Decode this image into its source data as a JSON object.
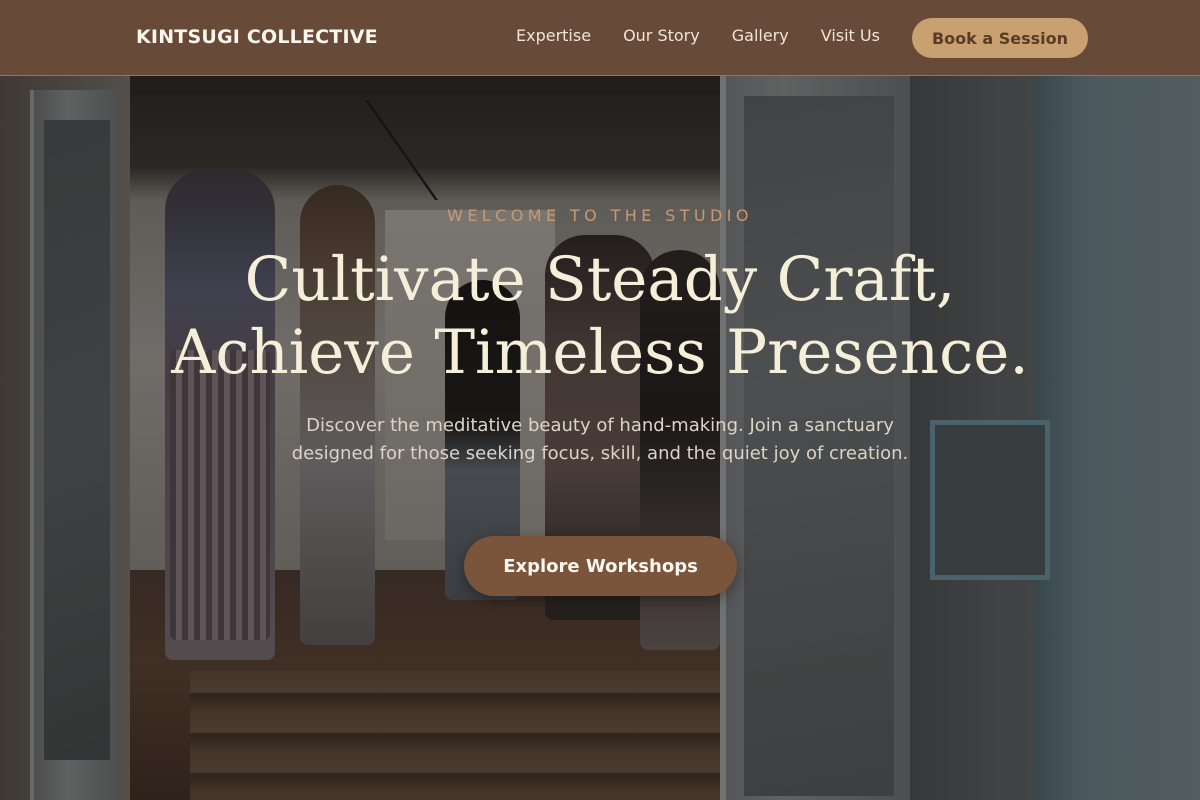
{
  "header": {
    "logo": "KINTSUGI COLLECTIVE",
    "nav": [
      {
        "label": "Expertise"
      },
      {
        "label": "Our Story"
      },
      {
        "label": "Gallery"
      },
      {
        "label": "Visit Us"
      }
    ],
    "cta_label": "Book a Session"
  },
  "hero": {
    "eyebrow": "WELCOME TO THE STUDIO",
    "headline_line1": "Cultivate Steady Craft,",
    "headline_line2": "Achieve Timeless Presence.",
    "subtext": "Discover the meditative beauty of hand-making. Join a sanctuary designed for those seeking focus, skill, and the quiet joy of creation.",
    "cta_label": "Explore Workshops"
  },
  "colors": {
    "header_bg": "#6d4c3a",
    "accent_tan": "#c9a070",
    "cta_brown": "#7a543b",
    "headline_cream": "#f5efd9",
    "eyebrow": "#c79a72"
  }
}
